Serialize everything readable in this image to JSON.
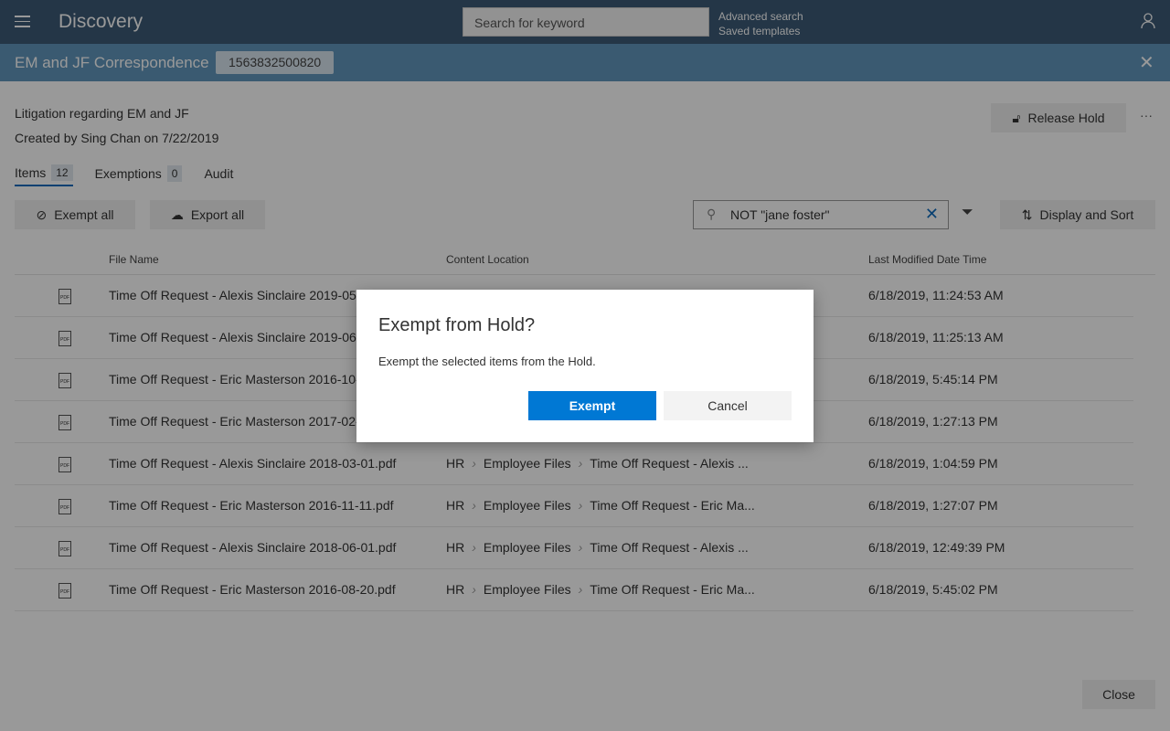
{
  "header": {
    "app_title": "Discovery",
    "search_placeholder": "Search for keyword",
    "advanced_search": "Advanced search",
    "saved_templates": "Saved templates"
  },
  "hold": {
    "title": "EM and JF Correspondence",
    "id": "1563832500820",
    "description": "Litigation regarding EM and JF",
    "created": "Created by Sing Chan on 7/22/2019",
    "release_label": "Release Hold",
    "more": "···"
  },
  "tabs": [
    {
      "label": "Items",
      "count": "12"
    },
    {
      "label": "Exemptions",
      "count": "0"
    },
    {
      "label": "Audit"
    }
  ],
  "toolbar": {
    "exempt_all": "Exempt all",
    "export_all": "Export all",
    "filter_value": "NOT \"jane foster\"",
    "display_sort": "Display and Sort"
  },
  "table": {
    "columns": [
      "File Name",
      "Content Location",
      "Last Modified Date Time"
    ],
    "rows": [
      {
        "name": "Time Off Request - Alexis Sinclaire 2019-05-",
        "loc": [
          "",
          "",
          ""
        ],
        "date": "6/18/2019, 11:24:53 AM"
      },
      {
        "name": "Time Off Request - Alexis Sinclaire 2019-06-",
        "loc": [
          "",
          "",
          ""
        ],
        "date": "6/18/2019, 11:25:13 AM"
      },
      {
        "name": "Time Off Request - Eric Masterson 2016-10-",
        "loc": [
          "",
          "",
          ""
        ],
        "date": "6/18/2019, 5:45:14 PM"
      },
      {
        "name": "Time Off Request - Eric Masterson 2017-02-",
        "loc": [
          "",
          "",
          ""
        ],
        "date": "6/18/2019, 1:27:13 PM"
      },
      {
        "name": "Time Off Request - Alexis Sinclaire 2018-03-01.pdf",
        "loc": [
          "HR",
          "Employee Files",
          "Time Off Request - Alexis ..."
        ],
        "date": "6/18/2019, 1:04:59 PM"
      },
      {
        "name": "Time Off Request - Eric Masterson 2016-11-11.pdf",
        "loc": [
          "HR",
          "Employee Files",
          "Time Off Request - Eric Ma..."
        ],
        "date": "6/18/2019, 1:27:07 PM"
      },
      {
        "name": "Time Off Request - Alexis Sinclaire 2018-06-01.pdf",
        "loc": [
          "HR",
          "Employee Files",
          "Time Off Request - Alexis ..."
        ],
        "date": "6/18/2019, 12:49:39 PM"
      },
      {
        "name": "Time Off Request - Eric Masterson 2016-08-20.pdf",
        "loc": [
          "HR",
          "Employee Files",
          "Time Off Request - Eric Ma..."
        ],
        "date": "6/18/2019, 5:45:02 PM"
      }
    ]
  },
  "footer": {
    "close": "Close"
  },
  "dialog": {
    "title": "Exempt from Hold?",
    "message": "Exempt the selected items from the Hold.",
    "confirm": "Exempt",
    "cancel": "Cancel",
    "accent": "#0078d4"
  }
}
